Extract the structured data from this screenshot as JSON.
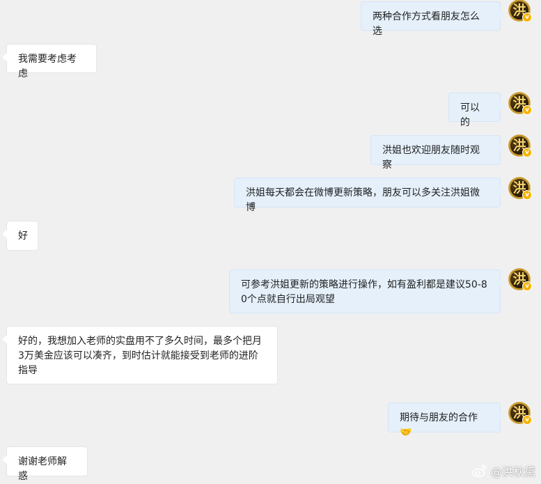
{
  "messages": [
    {
      "side": "out",
      "text": "两种合作方式看朋友怎么选",
      "avatar_glyph": "洪"
    },
    {
      "side": "in",
      "text": "我需要考虑考虑"
    },
    {
      "side": "out",
      "text": "可以的",
      "avatar_glyph": "洪"
    },
    {
      "side": "out",
      "text": "洪姐也欢迎朋友随时观察",
      "avatar_glyph": "洪"
    },
    {
      "side": "out",
      "text": "洪姐每天都会在微博更新策略，朋友可以多关注洪姐微博",
      "avatar_glyph": "洪"
    },
    {
      "side": "in",
      "text": "好"
    },
    {
      "side": "out",
      "text": "可参考洪姐更新的策略进行操作，如有盈利都是建议50-80个点就自行出局观望",
      "avatar_glyph": "洪"
    },
    {
      "side": "in",
      "text": "好的，我想加入老师的实盘用不了多久时间，最多个把月3万美金应该可以凑齐，到时估计就能接受到老师的进阶指导"
    },
    {
      "side": "out",
      "text": "期待与朋友的合作🤝",
      "avatar_glyph": "洪"
    },
    {
      "side": "in",
      "text": "谢谢老师解惑"
    }
  ],
  "watermark": {
    "text": "@洪秋黛",
    "icon": "weibo-icon"
  },
  "colors": {
    "background": "#f0f0f0",
    "incoming_bubble": "#ffffff",
    "outgoing_bubble": "#e5f0fb",
    "avatar_ring": "#c79b2d",
    "verified_badge": "#f6b300"
  }
}
